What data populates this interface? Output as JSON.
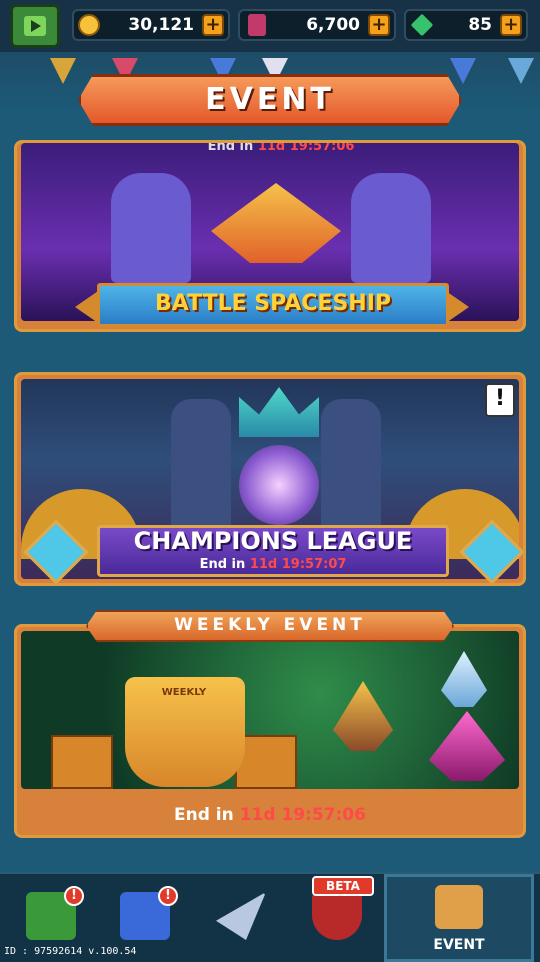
{
  "topbar": {
    "coins": "30,121",
    "tickets": "6,700",
    "gems": "85",
    "plus_label": "+"
  },
  "header": {
    "title": "EVENT"
  },
  "events": {
    "battle": {
      "title": "BATTLE SPACESHIP",
      "timer_prefix": "End in",
      "timer_value": "11d 19:57:06"
    },
    "champions": {
      "title": "CHAMPIONS LEAGUE",
      "timer_prefix": "End in",
      "timer_value": "11d 19:57:07",
      "alert": "!"
    },
    "weekly": {
      "label": "WEEKLY EVENT",
      "trophy_text": "WEEKLY",
      "timer_prefix": "End in",
      "timer_value": "11d 19:57:06"
    }
  },
  "bottom_nav": {
    "items": [
      {
        "icon": "treasure-chest-icon",
        "badge": "!"
      },
      {
        "icon": "blue-crate-icon",
        "badge": "!"
      },
      {
        "icon": "spaceship-icon"
      },
      {
        "icon": "shield-lock-icon",
        "badge": "BETA"
      },
      {
        "icon": "event-icon",
        "label": "EVENT"
      }
    ]
  },
  "footer": {
    "version": "ID : 97592614 v.100.54"
  },
  "colors": {
    "accent_orange": "#e4582b",
    "gold": "#ffd23a",
    "timer_red": "#ff4a4a",
    "background": "#1c5a78"
  }
}
